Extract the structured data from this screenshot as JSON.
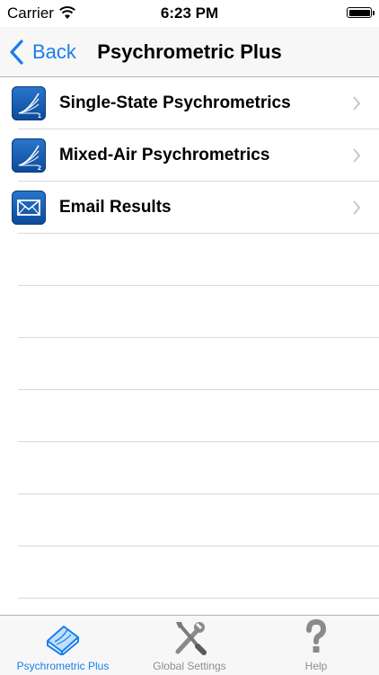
{
  "status_bar": {
    "carrier": "Carrier",
    "time": "6:23 PM"
  },
  "nav": {
    "back_label": "Back",
    "title": "Psychrometric Plus"
  },
  "list": {
    "items": [
      {
        "label": "Single-State Psychrometrics",
        "icon": "psychrometric-chart-1-icon",
        "badge": "1"
      },
      {
        "label": "Mixed-Air Psychrometrics",
        "icon": "psychrometric-chart-2-icon",
        "badge": "2"
      },
      {
        "label": "Email Results",
        "icon": "envelope-icon"
      }
    ]
  },
  "tabs": [
    {
      "label": "Psychrometric Plus",
      "icon": "psychrometric-book-icon",
      "active": true
    },
    {
      "label": "Global Settings",
      "icon": "wrench-screwdriver-icon",
      "active": false
    },
    {
      "label": "Help",
      "icon": "question-mark-icon",
      "active": false
    }
  ],
  "colors": {
    "accent": "#1a7ee9",
    "icon_blue": "#1656a8",
    "inactive_tab": "#8e8e8e"
  }
}
